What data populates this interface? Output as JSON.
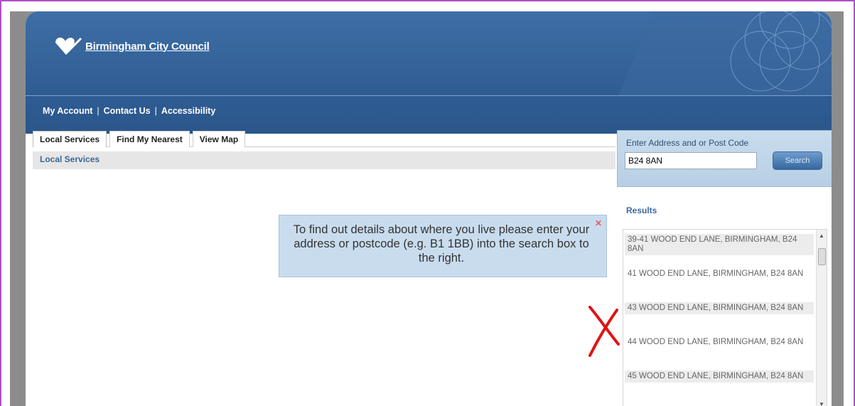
{
  "header": {
    "logo_text": "Birmingham City Council",
    "nav": [
      "My Account",
      "Contact Us",
      "Accessibility"
    ],
    "nav_separator": "|"
  },
  "tabs": [
    "Local Services",
    "Find My Nearest",
    "View Map"
  ],
  "breadcrumb": "Local Services",
  "search": {
    "label": "Enter Address and or Post Code",
    "value": "B24 8AN",
    "button": "Search"
  },
  "results": {
    "title": "Results",
    "items": [
      "39-41 WOOD END LANE, BIRMINGHAM, B24 8AN",
      "41 WOOD END LANE, BIRMINGHAM, B24 8AN",
      "43 WOOD END LANE, BIRMINGHAM, B24 8AN",
      "44 WOOD END LANE, BIRMINGHAM, B24 8AN",
      "45 WOOD END LANE, BIRMINGHAM, B24 8AN"
    ]
  },
  "tooltip": {
    "text": "To find out details about where you live please enter your address or postcode (e.g. B1 1BB) into the search box to the right.",
    "close_icon": "close-icon"
  },
  "colors": {
    "header_blue": "#2e5c92",
    "link_blue": "#3a6a9e",
    "search_panel": "#c9dced",
    "annotation_red": "#e01212"
  }
}
